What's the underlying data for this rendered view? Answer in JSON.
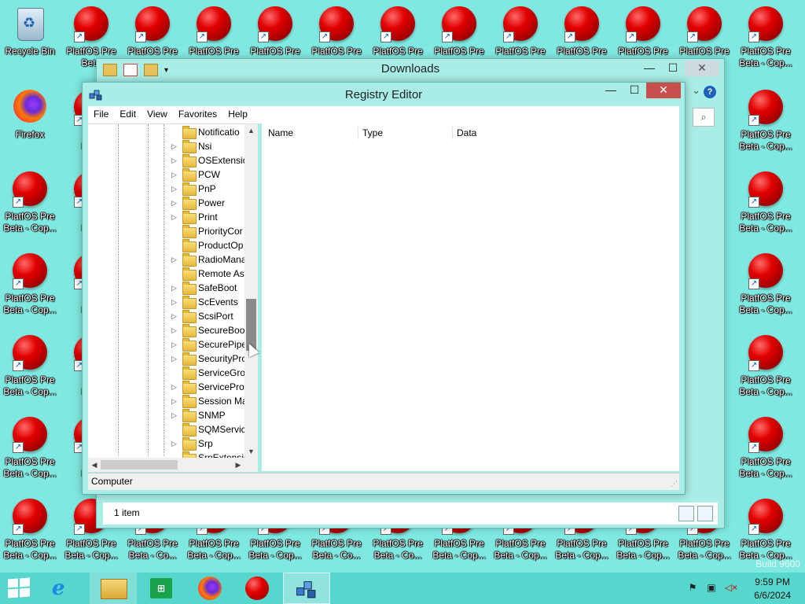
{
  "desktop": {
    "recycle_bin_label": "Recycle Bin",
    "firefox_label": "Firefox",
    "platf_top_label": "PlatfOS Pre",
    "platf_label_line1": "PlatfOS Pre",
    "platf_label_line2": "Beta - Cop...",
    "platf_label_line2_alt": "Beta - Co...",
    "platf_label_line2_short": "Beta",
    "platf_label_line2_partial": "Beta - C...",
    "platf_short_line1": "Pla",
    "platf_short_line2": "Beta",
    "build_watermark": "Build 9600"
  },
  "downloads_window": {
    "title": "Downloads",
    "status_count": "1 item",
    "minimize_glyph": "—",
    "maximize_glyph": "☐",
    "close_glyph": "✕",
    "help_glyph": "?",
    "search_glyph": "⌕",
    "chevron_glyph": "⌄"
  },
  "registry_editor": {
    "title": "Registry Editor",
    "menu": [
      "File",
      "Edit",
      "View",
      "Favorites",
      "Help"
    ],
    "minimize_glyph": "—",
    "maximize_glyph": "☐",
    "close_glyph": "✕",
    "tree_items": [
      {
        "label": "Notificatio",
        "expandable": false
      },
      {
        "label": "Nsi",
        "expandable": true
      },
      {
        "label": "OSExtensio",
        "expandable": true
      },
      {
        "label": "PCW",
        "expandable": true
      },
      {
        "label": "PnP",
        "expandable": true
      },
      {
        "label": "Power",
        "expandable": true
      },
      {
        "label": "Print",
        "expandable": true
      },
      {
        "label": "PriorityCor",
        "expandable": false
      },
      {
        "label": "ProductOp",
        "expandable": false
      },
      {
        "label": "RadioMana",
        "expandable": true
      },
      {
        "label": "Remote As",
        "expandable": false
      },
      {
        "label": "SafeBoot",
        "expandable": true
      },
      {
        "label": "ScEvents",
        "expandable": true
      },
      {
        "label": "ScsiPort",
        "expandable": true
      },
      {
        "label": "SecureBoot",
        "expandable": true
      },
      {
        "label": "SecurePipe",
        "expandable": true
      },
      {
        "label": "SecurityPro",
        "expandable": true
      },
      {
        "label": "ServiceGro",
        "expandable": false
      },
      {
        "label": "ServiceProv",
        "expandable": true
      },
      {
        "label": "Session Ma",
        "expandable": true
      },
      {
        "label": "SNMP",
        "expandable": true
      },
      {
        "label": "SQMServic",
        "expandable": false
      },
      {
        "label": "Srp",
        "expandable": true
      },
      {
        "label": "SrpExtensio",
        "expandable": false
      }
    ],
    "columns": [
      "Name",
      "Type",
      "Data"
    ],
    "status_path": "Computer"
  },
  "taskbar": {
    "clock_time": "9:59 PM",
    "clock_date": "6/6/2024",
    "start_label": "Start",
    "ie_glyph": "e"
  },
  "colors": {
    "desktop_bg": "#7fe8e0",
    "window_frame": "#a9ede6",
    "close_button": "#c7504f",
    "taskbar": "#56d6cc"
  }
}
